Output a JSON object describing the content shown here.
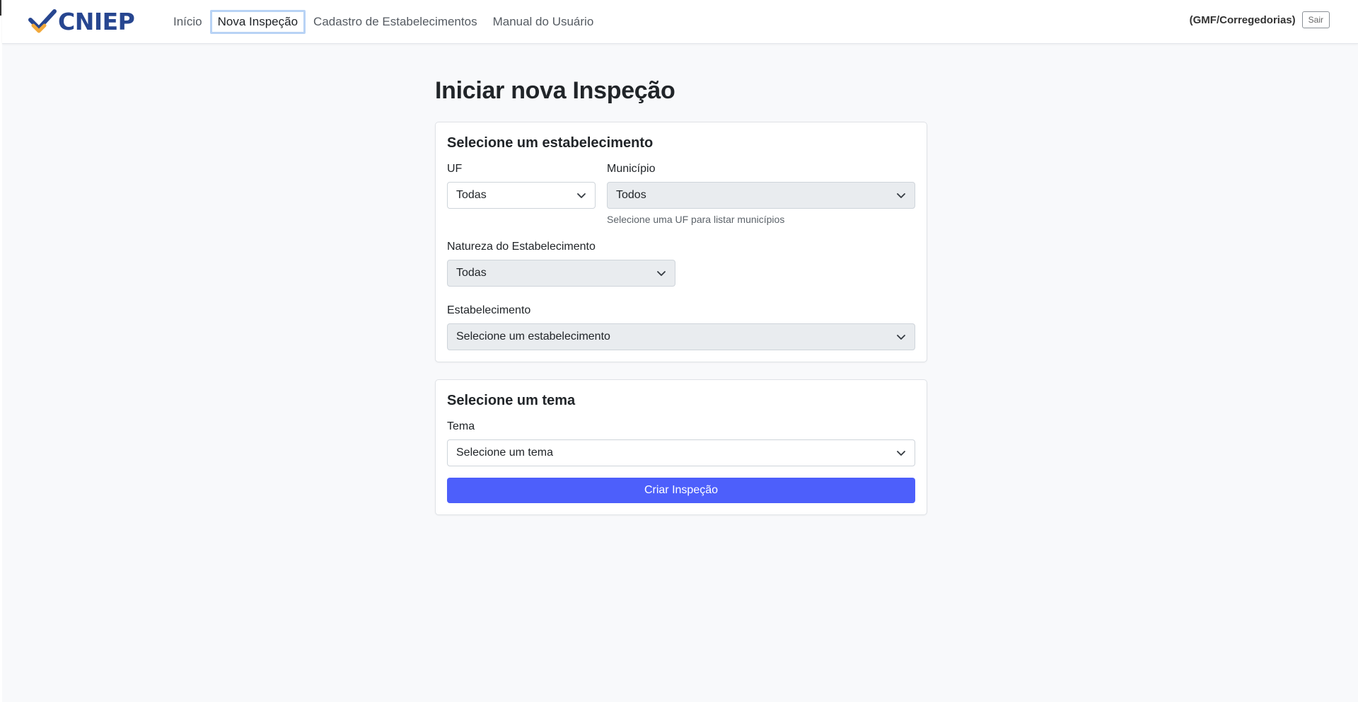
{
  "brand": {
    "name": "CNIEP"
  },
  "nav": {
    "items": [
      {
        "label": "Início"
      },
      {
        "label": "Nova Inspeção"
      },
      {
        "label": "Cadastro de Estabelecimentos"
      },
      {
        "label": "Manual do Usuário"
      }
    ],
    "active_index": 1
  },
  "user": {
    "label": "(GMF/Corregedorias)",
    "logout_label": "Sair"
  },
  "page": {
    "title": "Iniciar nova Inspeção"
  },
  "establishment_card": {
    "title": "Selecione um estabelecimento",
    "uf": {
      "label": "UF",
      "value": "Todas"
    },
    "municipio": {
      "label": "Município",
      "value": "Todos",
      "help": "Selecione uma UF para listar municípios"
    },
    "natureza": {
      "label": "Natureza do Estabelecimento",
      "value": "Todas"
    },
    "estabelecimento": {
      "label": "Estabelecimento",
      "value": "Selecione um estabelecimento"
    }
  },
  "theme_card": {
    "title": "Selecione um tema",
    "tema": {
      "label": "Tema",
      "value": "Selecione um tema"
    },
    "submit_label": "Criar Inspeção"
  },
  "colors": {
    "brand": "#274690",
    "brand_accent": "#f2a93b",
    "primary": "#4d5ffb",
    "active_outline": "#b8d3f5",
    "page_bg": "#f8f9fb"
  },
  "icons": {
    "logo": "checkmark-logo-icon",
    "select_arrow": "chevron-down-icon"
  }
}
